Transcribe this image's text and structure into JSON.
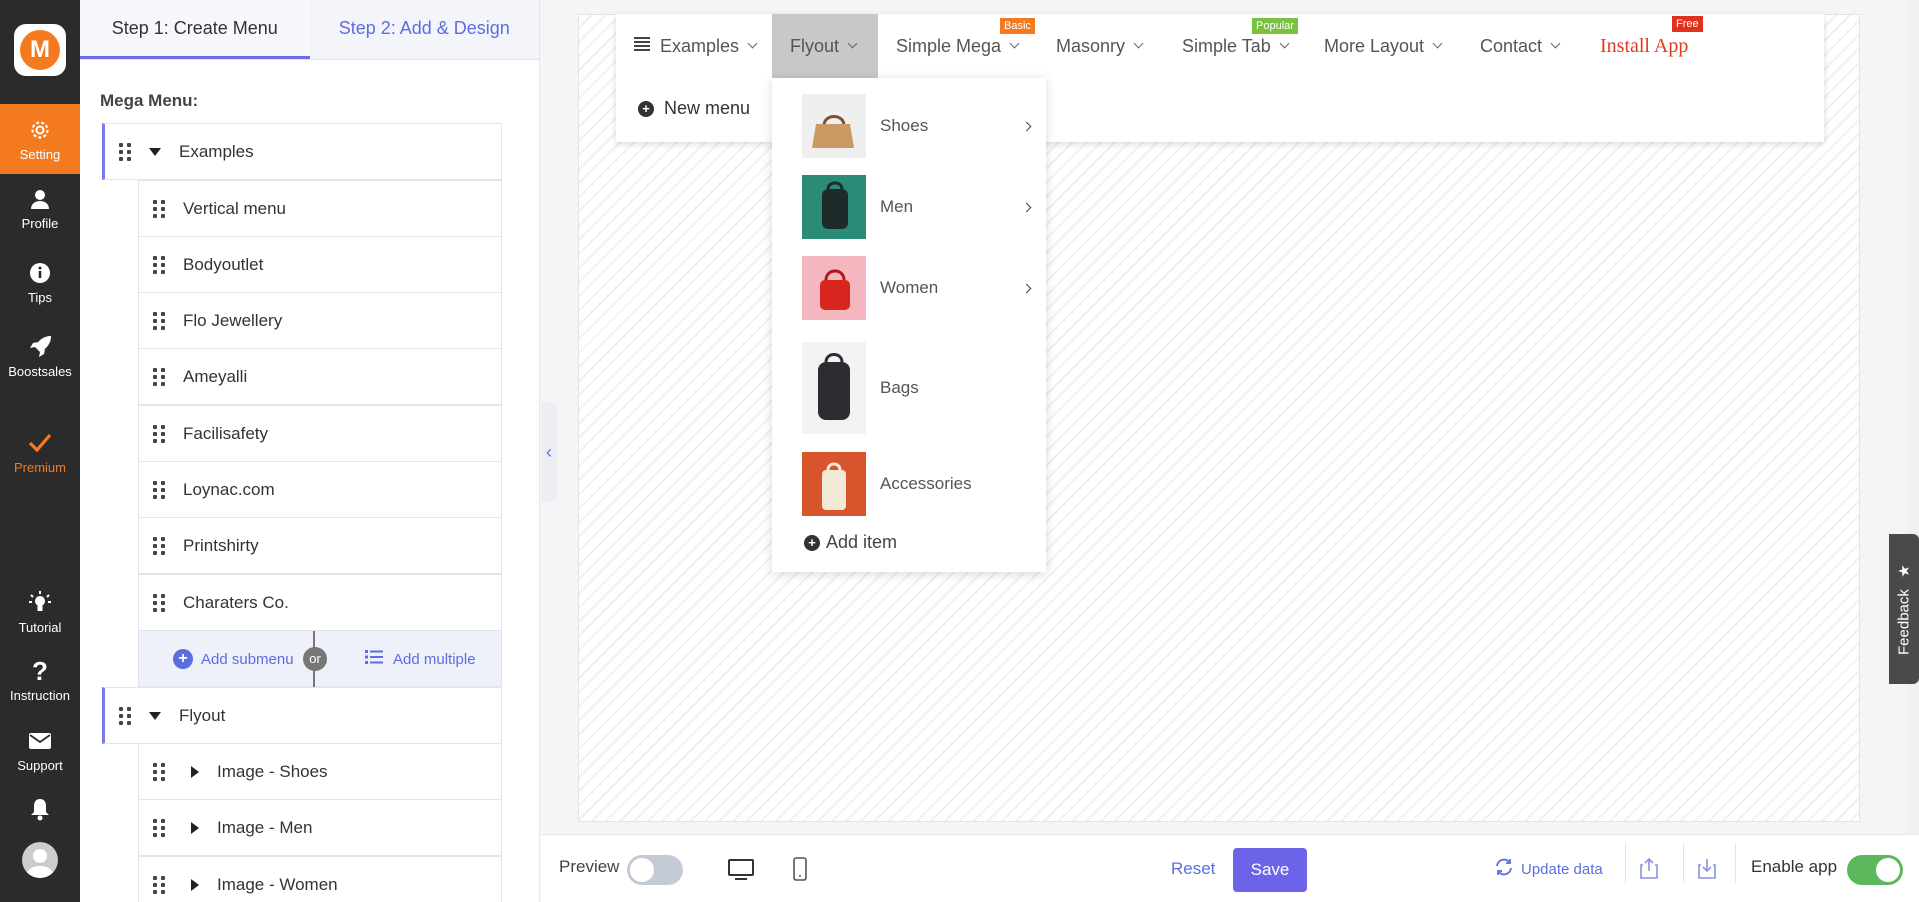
{
  "nav": {
    "logo": "M",
    "items": [
      {
        "label": "Setting",
        "icon": "gear-icon"
      },
      {
        "label": "Profile",
        "icon": "user-icon"
      },
      {
        "label": "Tips",
        "icon": "info-icon"
      },
      {
        "label": "Boostsales",
        "icon": "rocket-icon"
      },
      {
        "label": "Premium",
        "icon": "check-icon"
      },
      {
        "label": "Tutorial",
        "icon": "lightbulb-icon"
      },
      {
        "label": "Instruction",
        "icon": "question-icon"
      },
      {
        "label": "Support",
        "icon": "envelope-icon"
      }
    ]
  },
  "panel": {
    "tabs": [
      "Step 1: Create Menu",
      "Step 2: Add & Design"
    ],
    "label": "Mega Menu:",
    "tree": {
      "examples": "Examples",
      "children": [
        "Vertical menu",
        "Bodyoutlet",
        "Flo Jewellery",
        "Ameyalli",
        "Facilisafety",
        "Loynac.com",
        "Printshirty",
        "Charaters Co."
      ],
      "add_submenu": "Add submenu",
      "or": "or",
      "add_multiple": "Add multiple",
      "flyout": "Flyout",
      "flyout_children": [
        "Image - Shoes",
        "Image - Men",
        "Image - Women"
      ]
    }
  },
  "menubar": {
    "items": [
      {
        "label": "Examples",
        "badge": ""
      },
      {
        "label": "Flyout",
        "badge": ""
      },
      {
        "label": "Simple Mega",
        "badge": "Basic"
      },
      {
        "label": "Masonry",
        "badge": ""
      },
      {
        "label": "Simple Tab",
        "badge": "Popular"
      },
      {
        "label": "More Layout",
        "badge": ""
      },
      {
        "label": "Contact",
        "badge": ""
      },
      {
        "label": "Install App",
        "badge": "Free"
      }
    ],
    "new_menu": "New menu",
    "badge_colors": {
      "Basic": "#f47a20",
      "Popular": "#7ac142",
      "Free": "#e0301e"
    }
  },
  "dropdown": {
    "items": [
      "Shoes",
      "Men",
      "Women",
      "Bags",
      "Accessories"
    ],
    "add_item": "Add item"
  },
  "bottombar": {
    "preview": "Preview",
    "reset": "Reset",
    "save": "Save",
    "update_data": "Update data",
    "enable_app": "Enable app",
    "enable_app_on": true,
    "preview_on": false
  },
  "feedback": "Feedback",
  "colors": {
    "accent": "#6c63e8",
    "brand": "#f47a20",
    "link": "#5b6ee1"
  }
}
